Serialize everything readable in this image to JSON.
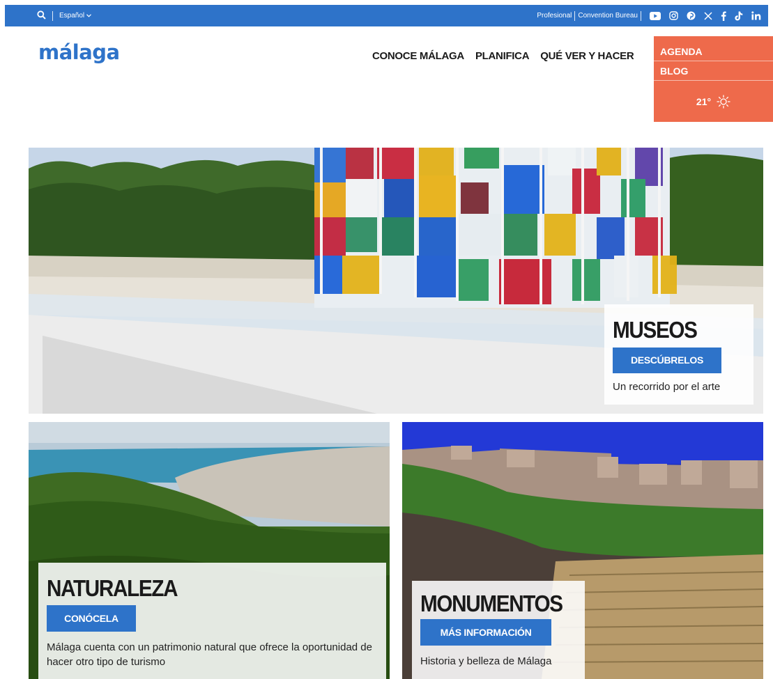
{
  "topbar": {
    "language": "Español",
    "links": [
      "Profesional",
      "Convention Bureau"
    ],
    "social_icons": [
      "youtube-icon",
      "instagram-icon",
      "pinterest-icon",
      "x-icon",
      "facebook-icon",
      "tiktok-icon",
      "linkedin-icon"
    ]
  },
  "header": {
    "logo": "málaga",
    "nav": [
      "CONOCE MÁLAGA",
      "PLANIFICA",
      "QUÉ VER Y HACER"
    ],
    "side_links": [
      "AGENDA",
      "BLOG"
    ],
    "temperature": "21°"
  },
  "hero": {
    "title": "MUSEOS",
    "button": "DESCÚBRELOS",
    "text": "Un recorrido por el arte"
  },
  "tiles": {
    "naturaleza": {
      "title": "NATURALEZA",
      "button": "CONÓCELA",
      "text": "Málaga cuenta con un patrimonio natural que ofrece la oportunidad de hacer otro tipo de turismo"
    },
    "monumentos": {
      "title": "MONUMENTOS",
      "button": "MÁS INFORMACIÓN",
      "text": "Historia y belleza de Málaga"
    }
  },
  "colors": {
    "brand_blue": "#2e73c9",
    "accent_orange": "#ee6a4b"
  }
}
